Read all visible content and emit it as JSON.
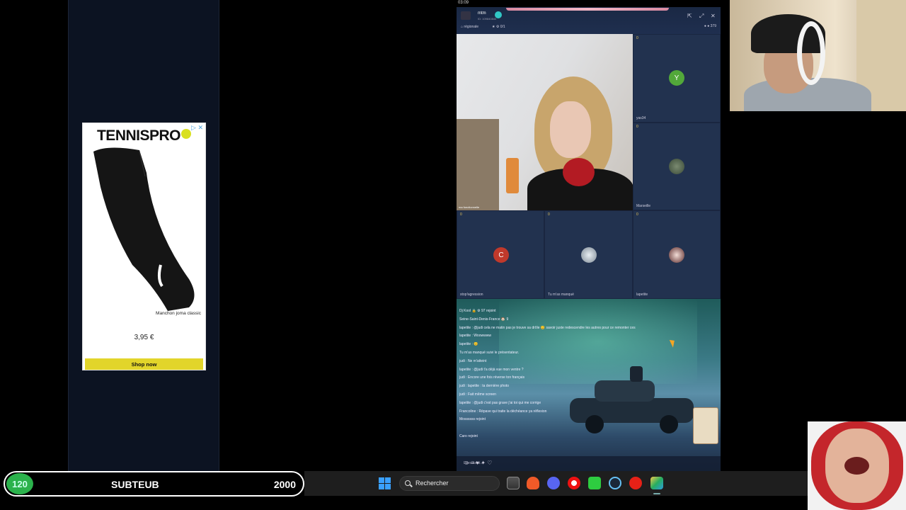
{
  "ad": {
    "close": "▷ ✕",
    "brand": "TENNISPRO",
    "product_name": "Manchon joma classic",
    "price": "3,95 €",
    "cta": "Shop now"
  },
  "os_clock": "03:09",
  "room": {
    "title": "mtm",
    "subtitle": "ID: 109840840",
    "tag_region": "régionale",
    "tag_stats": "0/1",
    "viewers": "379"
  },
  "seats": [
    {
      "num": "0",
      "name": "ma fonctionnelle",
      "avatar": ""
    },
    {
      "num": "0",
      "name": "yas34",
      "avatar": "Y",
      "color": "#52a83a"
    },
    {
      "num": "0",
      "name": "Marseille",
      "avatar": "",
      "color": "#5b6a50"
    },
    {
      "num": "0",
      "name": "stop!agression",
      "avatar": "C",
      "color": "#c0392b"
    },
    {
      "num": "0",
      "name": "Tu m'as manqué",
      "avatar": "",
      "color": "#aab4c0"
    },
    {
      "num": "0",
      "name": "lapetite",
      "avatar": "",
      "color": "#d8b7b0"
    }
  ],
  "chat": {
    "lines": [
      "Dj Kool 🔒 ⚙ 97 rejoint",
      "Seine-Saint-Denis-France 🏠 9",
      "lapetite : @judi cela ne matin pas je trouve sa drôle 😊 savoir juste redescendre les autres pour ce remonter ces",
      "lapetite : Woowwww",
      "lapetite : 😊",
      "Tu m'as manqué suivi le présentateur.",
      "judi : Ne m'atteint",
      "lapetite : @judi t'a déjà vue mon ventre ?",
      "judi : Encore une fois réverse ton français",
      "judi : lapetite : ta dernière photo",
      "judi : Fait même screen",
      "lapetite : @judi c'est pas grave j'ai toi qui me corrige",
      "Francoline : Répave qui traite la déchéance ya réflexion",
      "Mossssss rejoint",
      "",
      "Caro rejoint"
    ],
    "input_placeholder": "Dites salut..."
  },
  "subgoal": {
    "count": "120",
    "label": "SUBTEUB",
    "goal": "2000"
  },
  "taskbar": {
    "search_label": "Rechercher"
  }
}
